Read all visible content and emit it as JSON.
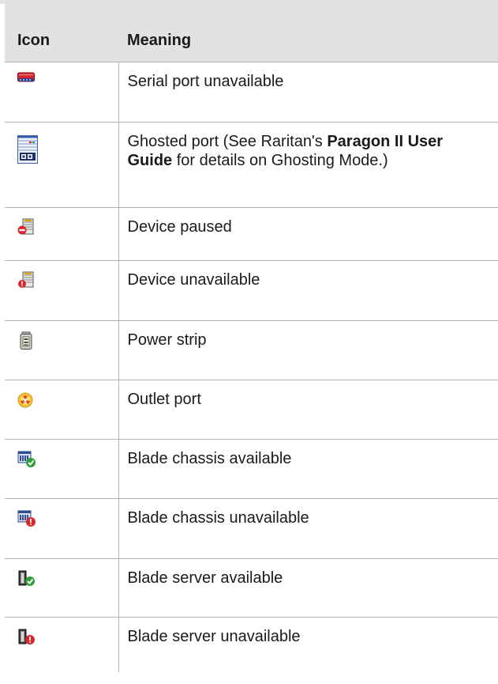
{
  "table": {
    "header": {
      "icon": "Icon",
      "meaning": "Meaning"
    },
    "rows": [
      {
        "icon": "serial-port-unavailable-icon",
        "meaning": "Serial port unavailable"
      },
      {
        "icon": "ghosted-port-icon",
        "meaning_parts": [
          "Ghosted port (See Raritan's ",
          "Paragon II User Guide",
          " for details on Ghosting Mode.)"
        ]
      },
      {
        "icon": "device-paused-icon",
        "meaning": "Device paused"
      },
      {
        "icon": "device-unavailable-icon",
        "meaning": "Device unavailable"
      },
      {
        "icon": "power-strip-icon",
        "meaning": "Power strip"
      },
      {
        "icon": "outlet-port-icon",
        "meaning": "Outlet port"
      },
      {
        "icon": "blade-chassis-available-icon",
        "meaning": "Blade chassis available"
      },
      {
        "icon": "blade-chassis-unavailable-icon",
        "meaning": "Blade chassis unavailable"
      },
      {
        "icon": "blade-server-available-icon",
        "meaning": "Blade server available"
      },
      {
        "icon": "blade-server-unavailable-icon",
        "meaning": "Blade server unavailable"
      }
    ]
  },
  "colors": {
    "header_bg": "#e2e2e2",
    "grid": "#b4b4b4",
    "unavailable_red": "#d9262c",
    "available_green": "#2e9e3a"
  }
}
